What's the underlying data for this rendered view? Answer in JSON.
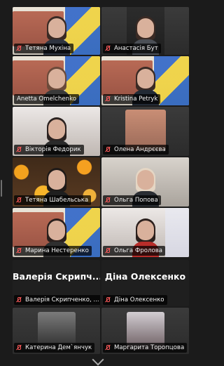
{
  "participants": [
    {
      "name": "Тетяна Мухіна"
    },
    {
      "name": "Анастасія Бут"
    },
    {
      "name": "Anetta Omelchenko"
    },
    {
      "name": "Kristina Petryk"
    },
    {
      "name": "Вікторія Федорик"
    },
    {
      "name": "Олена Андрєєва"
    },
    {
      "name": "Тетяна Шабельська"
    },
    {
      "name": "Ольга Попова"
    },
    {
      "name": "Марина Нестеренко"
    },
    {
      "name": "Ольга Фролова"
    },
    {
      "name": "Валерія Скрипченко, ...",
      "display": "Валерія Скрипч..."
    },
    {
      "name": "Діна Олексенко",
      "display": "Діна Олексенко"
    },
    {
      "name": "Катерина Дем`янчук"
    },
    {
      "name": "Маргарита Торопцова"
    }
  ]
}
